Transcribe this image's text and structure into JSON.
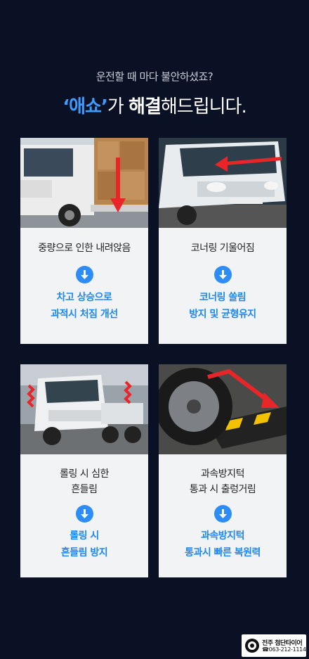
{
  "header": {
    "subtitle": "운전할 때 마다 불안하셨죠?",
    "title_quote": "‘애쇼’",
    "title_ga": "가 ",
    "title_bold": "해결",
    "title_rest": "해드립니다."
  },
  "cards": [
    {
      "problem_line1": "중량으로 인한 내려앉음",
      "problem_line2": "",
      "solution_line1": "차고 상승으로",
      "solution_line2": "과적시 처짐 개선"
    },
    {
      "problem_line1": "코너링 기울어짐",
      "problem_line2": "",
      "solution_line1": "코너링 쏠림",
      "solution_line2": "방지 및 균형유지"
    },
    {
      "problem_line1": "롤링 시 심한",
      "problem_line2": "흔들림",
      "solution_line1": "롤링 시",
      "solution_line2": "흔들림 방지"
    },
    {
      "problem_line1": "과속방지턱",
      "problem_line2": "통과 시 출렁거림",
      "solution_line1": "과속방지턱",
      "solution_line2": "통과시 빠른 복원력"
    }
  ],
  "badge": {
    "name": "전주 첨단타이어",
    "phone": "☎063-212-1114"
  },
  "colors": {
    "background": "#0b1124",
    "accent_blue": "#2d8cf5",
    "arrow_red": "#e8262a"
  }
}
